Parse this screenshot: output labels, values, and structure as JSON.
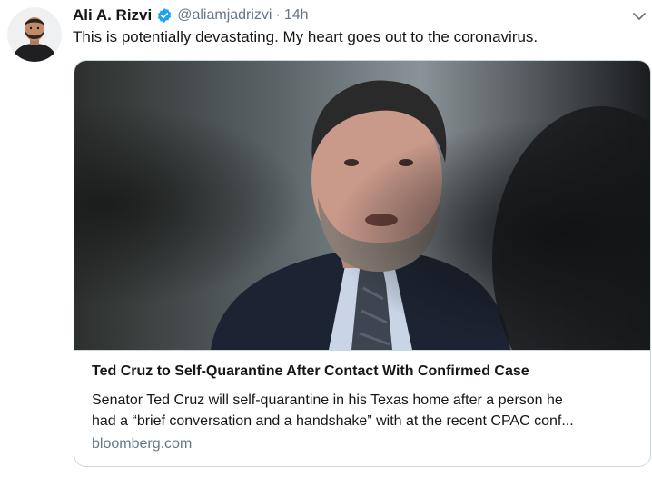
{
  "tweet": {
    "author": {
      "name": "Ali A. Rizvi",
      "handle": "@aliamjadrizvi",
      "verified": true,
      "avatar_icon": "user-avatar"
    },
    "separator": "·",
    "time": "14h",
    "text": "This is potentially devastating. My heart goes out to the coronavirus.",
    "menu_icon": "chevron-down-icon"
  },
  "card": {
    "image_icon": "news-photo",
    "title": "Ted Cruz to Self-Quarantine After Contact With Confirmed Case",
    "description_lines": [
      "Senator Ted Cruz will self-quarantine in his Texas home after a person he",
      "had a “brief conversation and a handshake” with at the recent CPAC conf..."
    ],
    "domain": "bloomberg.com"
  },
  "colors": {
    "text_primary": "#14171a",
    "text_secondary": "#657786",
    "verified_blue": "#1da1f2",
    "border": "#ccd6dd"
  }
}
